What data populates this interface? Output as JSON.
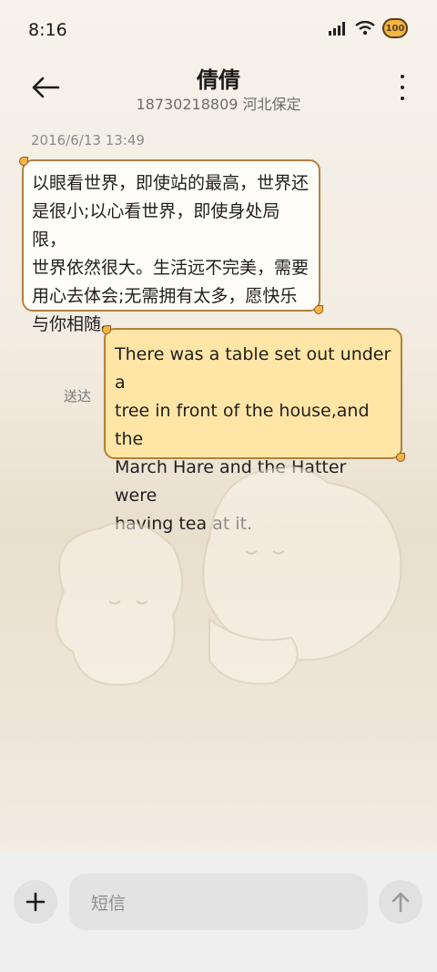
{
  "status": {
    "time": "8:16",
    "battery_label": "100"
  },
  "header": {
    "contact_name": "倩倩",
    "contact_info": "18730218809 河北保定"
  },
  "conversation": {
    "timestamp": "2016/6/13 13:49",
    "incoming": {
      "lines": [
        "以眼看世界，即使站的最高，世界还",
        "是很小;以心看世界，即使身处局限，",
        "世界依然很大。生活远不完美，需要",
        "用心去体会;无需拥有太多，愿快乐",
        "与你相随。"
      ]
    },
    "outgoing": {
      "lines": [
        "There was a table set out under a",
        "tree in front of the house,and the",
        "March Hare and the Hatter were",
        "having tea at it."
      ],
      "status": "送达"
    }
  },
  "composer": {
    "placeholder": "短信"
  },
  "colors": {
    "bubble_border": "#b08140",
    "outgoing_bubble": "#ffe6a6",
    "incoming_bubble": "#fffdf8"
  },
  "icons": [
    "signal-icon",
    "wifi-icon",
    "battery-icon",
    "back-arrow-icon",
    "more-vertical-icon",
    "plus-icon",
    "send-arrow-icon"
  ]
}
